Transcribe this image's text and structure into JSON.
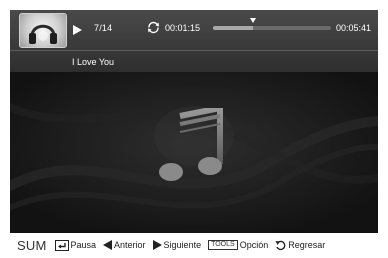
{
  "player": {
    "track_counter": "7/14",
    "elapsed_time": "00:01:15",
    "total_time": "00:05:41",
    "progress_fraction": 0.34,
    "song_title": "I Love You"
  },
  "help_bar": {
    "brand": "SUM",
    "items": [
      {
        "icon": "enter-icon",
        "label": "Pausa"
      },
      {
        "icon": "left-arrow-icon",
        "label": "Anterior"
      },
      {
        "icon": "right-arrow-icon",
        "label": "Siguiente"
      },
      {
        "icon": "tools-key",
        "key": "TOOLS",
        "label": "Opción"
      },
      {
        "icon": "return-icon",
        "label": "Regresar"
      }
    ]
  },
  "colors": {
    "panel_top": "#4a4a4a",
    "panel_bottom": "#2e2e2e",
    "background": "#141414",
    "text": "#ffffff"
  }
}
